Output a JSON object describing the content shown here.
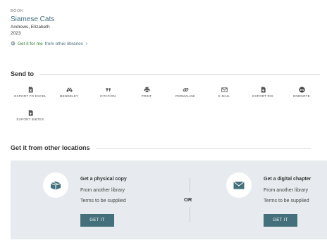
{
  "record": {
    "type": "BOOK",
    "title": "Siamese Cats",
    "author": "Andrews, Elizabeth",
    "year": "2023",
    "getit_link": {
      "part1": "Get it for me",
      "part2": "from other libraries",
      "chevron": "›"
    }
  },
  "send_to": {
    "title": "Send to",
    "actions": [
      {
        "label": "EXPORT TO EXCEL",
        "icon": "excel-icon"
      },
      {
        "label": "MENDELEY",
        "icon": "mendeley-icon"
      },
      {
        "label": "CITATION",
        "icon": "quote-icon"
      },
      {
        "label": "PRINT",
        "icon": "printer-icon"
      },
      {
        "label": "PERMALINK",
        "icon": "link-icon"
      },
      {
        "label": "E-MAIL",
        "icon": "envelope-icon"
      },
      {
        "label": "EXPORT RIS",
        "icon": "file-icon"
      },
      {
        "label": "ENDNOTE",
        "icon": "endnote-icon"
      },
      {
        "label": "EXPORT BIBTEX",
        "icon": "file-icon"
      }
    ]
  },
  "get_it": {
    "title": "Get it from other locations",
    "physical": {
      "title": "Get a physical copy",
      "from": "From another library",
      "terms": "Terms to be supplied",
      "button": "GET IT",
      "icon": "package-icon"
    },
    "or_label": "OR",
    "digital": {
      "title": "Get a digital chapter",
      "from": "From another library",
      "terms": "Terms to be supplied",
      "button": "GET IT",
      "icon": "envelope-icon"
    }
  },
  "colors": {
    "link": "#44707b",
    "green": "#2e7d32",
    "panel": "#e7ebef",
    "button": "#44707b"
  }
}
